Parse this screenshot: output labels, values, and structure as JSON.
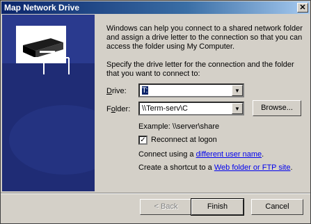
{
  "window": {
    "title": "Map Network Drive",
    "close_label": "✕"
  },
  "intro": {
    "line1": "Windows can help you connect to a shared network folder",
    "line2": "and assign a drive letter to the connection so that you can",
    "line3": "access the folder using My Computer."
  },
  "instructions": {
    "line1": "Specify the drive letter for the connection and the folder",
    "line2": "that you want to connect to:"
  },
  "drive": {
    "label": "Drive:",
    "accesskey": "D",
    "value": "T:"
  },
  "folder": {
    "label": "Folder:",
    "accesskey": "o",
    "value": "\\\\Term-serv\\C",
    "browse_label": "Browse..."
  },
  "example": "Example: \\\\server\\share",
  "reconnect": {
    "label": "Reconnect at logon",
    "checked": true
  },
  "connect_using": {
    "prefix": "Connect using a ",
    "link": "different user name",
    "suffix": "."
  },
  "shortcut": {
    "prefix": "Create a shortcut to a ",
    "link": "Web folder or FTP site",
    "suffix": "."
  },
  "buttons": {
    "back": "< Back",
    "finish": "Finish",
    "cancel": "Cancel"
  },
  "colors": {
    "panel": "#2a3a8e",
    "titlebar_start": "#0a246a",
    "titlebar_end": "#a6caf0"
  },
  "icons": [
    "network-drive-icon",
    "dropdown-arrow-icon",
    "checkbox-check-icon",
    "close-icon"
  ]
}
